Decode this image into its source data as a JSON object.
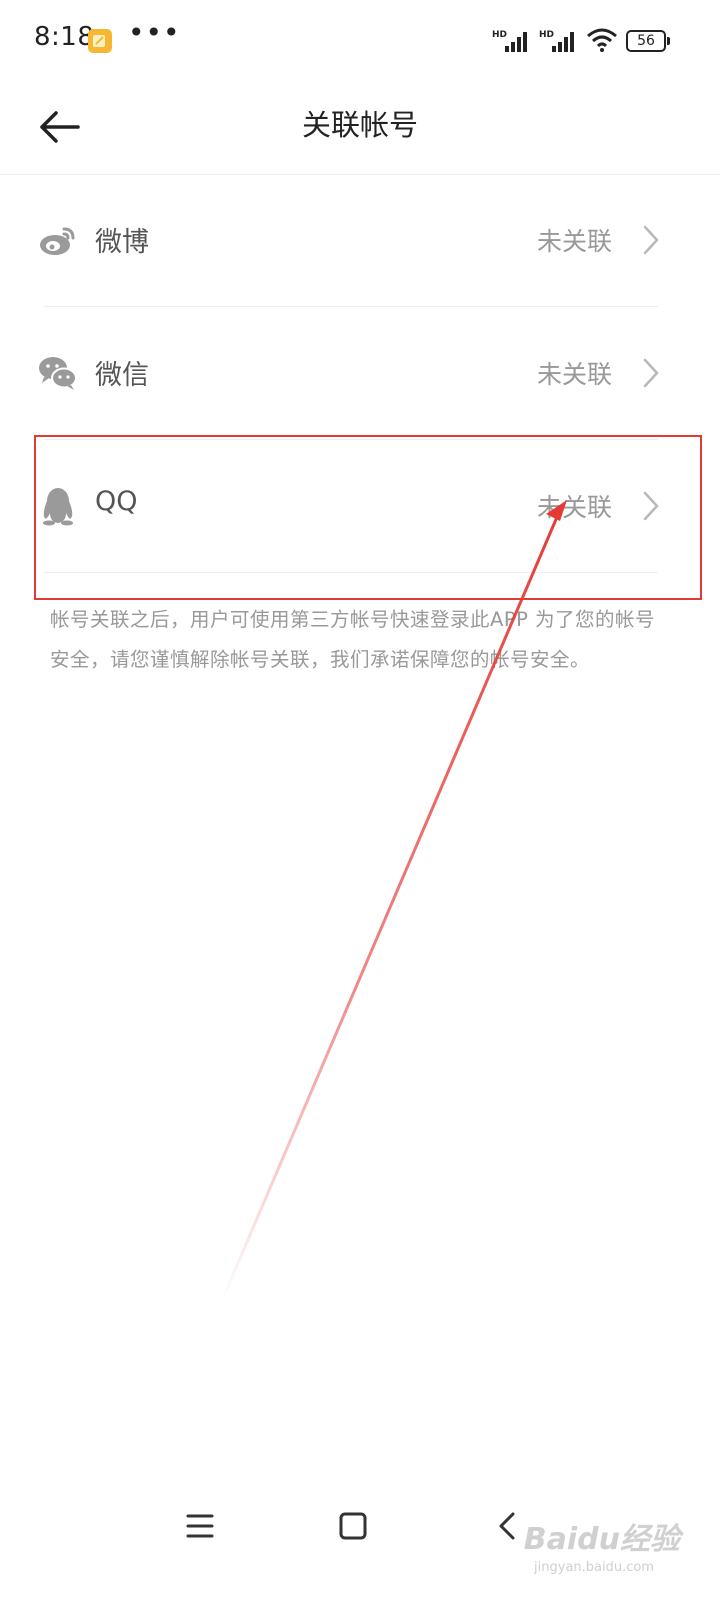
{
  "status_bar": {
    "time": "8:18",
    "more_dots": "•••",
    "hd_label": "HD",
    "battery": "56"
  },
  "header": {
    "title": "关联帐号",
    "back_icon": "arrow-left-icon"
  },
  "accounts": [
    {
      "label": "微博",
      "status": "未关联",
      "icon": "weibo-icon"
    },
    {
      "label": "微信",
      "status": "未关联",
      "icon": "wechat-icon"
    },
    {
      "label": "QQ",
      "status": "未关联",
      "icon": "qq-icon"
    }
  ],
  "notice": "帐号关联之后，用户可使用第三方帐号快速登录此APP 为了您的帐号安全，请您谨慎解除帐号关联，我们承诺保障您的帐号安全。",
  "nav_bar": {
    "icons": [
      "menu-icon",
      "home-square-icon",
      "back-chevron-icon"
    ]
  },
  "watermark": {
    "text": "Baidu经验",
    "sub": "jingyan.baidu.com"
  },
  "colors": {
    "annotation_red": "#e53935",
    "muted_text": "#999999"
  }
}
